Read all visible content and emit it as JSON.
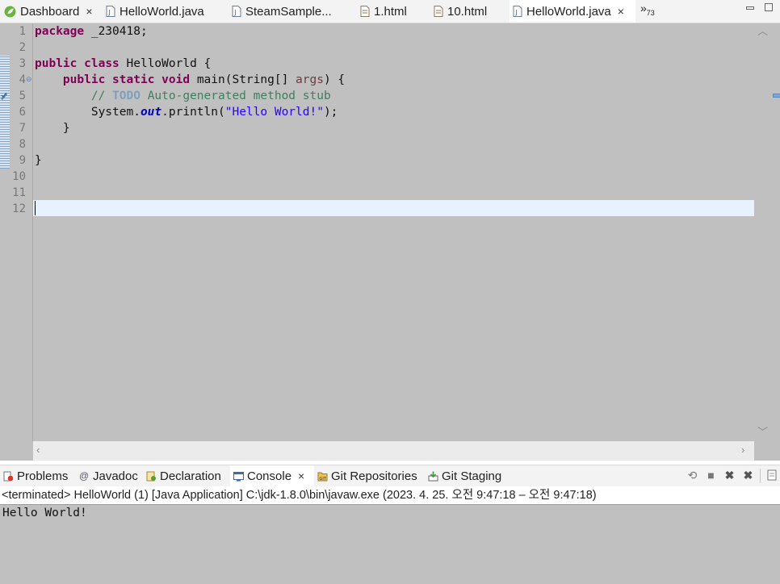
{
  "editor_tabs": [
    {
      "label": "Dashboard",
      "icon": "spring-icon",
      "closable": true
    },
    {
      "label": "HelloWorld.java",
      "icon": "java-file-icon"
    },
    {
      "label": "SteamSample...",
      "icon": "java-file-icon"
    },
    {
      "label": "1.html",
      "icon": "html-file-icon"
    },
    {
      "label": "10.html",
      "icon": "html-file-icon"
    },
    {
      "label": "HelloWorld.java",
      "icon": "java-file-icon",
      "active": true,
      "closable": true
    }
  ],
  "overflow": {
    "glyph": "»",
    "count": "73"
  },
  "close_glyph": "×",
  "editor": {
    "line_numbers": [
      "1",
      "2",
      "3",
      "4",
      "5",
      "6",
      "7",
      "8",
      "9",
      "10",
      "11",
      "12"
    ],
    "lines": [
      "package _230418;",
      "",
      "public class HelloWorld {",
      "    public static void main(String[] args) {",
      "        // TODO Auto-generated method stub",
      "        System.out.println(\"Hello World!\");",
      "    }",
      "",
      "}",
      "",
      "",
      ""
    ],
    "current_line": 12
  },
  "panel_tabs": [
    {
      "label": "Problems",
      "icon": "problems-icon"
    },
    {
      "label": "Javadoc",
      "icon": "javadoc-icon"
    },
    {
      "label": "Declaration",
      "icon": "declaration-icon"
    },
    {
      "label": "Console",
      "icon": "console-icon",
      "active": true,
      "closable": true
    },
    {
      "label": "Git Repositories",
      "icon": "git-repositories-icon"
    },
    {
      "label": "Git Staging",
      "icon": "git-staging-icon"
    }
  ],
  "console": {
    "header": "<terminated> HelloWorld (1) [Java Application] C:\\jdk-1.8.0\\bin\\javaw.exe  (2023. 4. 25. 오전 9:47:18 – 오전 9:47:18)",
    "output": "Hello World!"
  },
  "colors": {
    "editor_bg": "#c0c0c0",
    "current_line": "#e8f2fe",
    "keyword": "#7f0055",
    "comment": "#3f7f5f",
    "string": "#2a00ff"
  }
}
